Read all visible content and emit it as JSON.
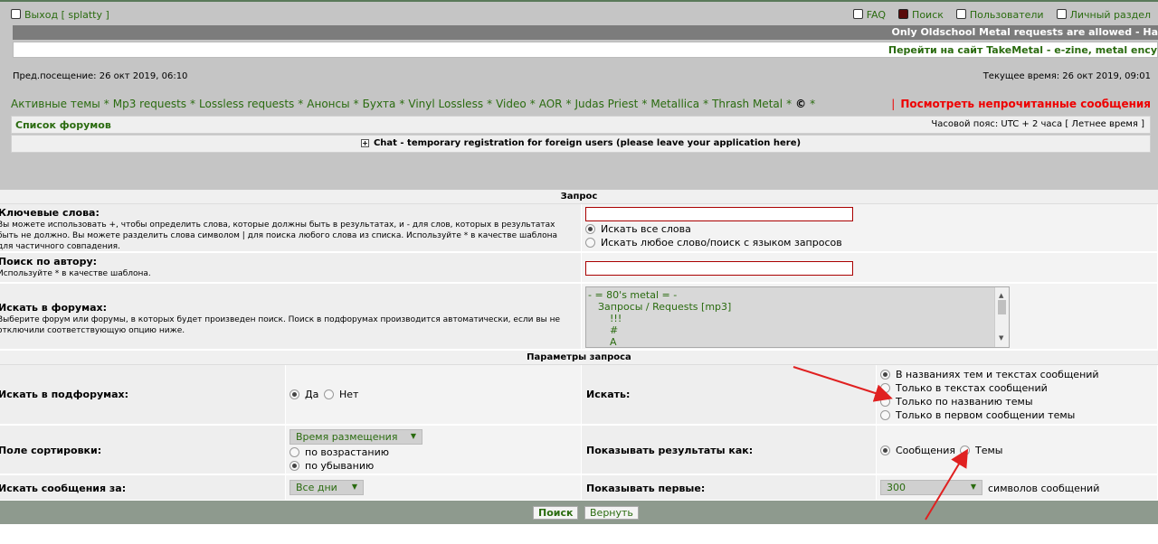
{
  "top": {
    "logout": "Выход [ splatty ]",
    "faq": "FAQ",
    "search": "Поиск",
    "users": "Пользователи",
    "personal": "Личный раздел"
  },
  "marquee1": "Only Oldschool Metal requests are allowed - Ha",
  "marquee2_link": "Перейти на сайт TakeMetal",
  "marquee2_rest": " - e-zine, metal ency",
  "last_visit": "Пред.посещение: 26 окт 2019, 06:10",
  "current_time": "Текущее время: 26 окт 2019, 09:01",
  "nav": [
    "Активные темы",
    "Mp3 requests",
    "Lossless requests",
    "Анонсы",
    "Бухта",
    "Vinyl Lossless",
    "Video",
    "AOR",
    "Judas Priest",
    "Metallica",
    "Thrash Metal"
  ],
  "nav_copy": "©",
  "nav_star": "*",
  "nav_sep": "*",
  "unread_bar": "|",
  "unread": "Посмотреть непрочитанные сообщения",
  "forum_list": "Список форумов",
  "timezone": "Часовой пояс: UTC + 2 часа [ Летнее время ]",
  "chat": "Chat - temporary registration for foreign users (please leave your application here)",
  "query_header": "Запрос",
  "keywords": {
    "label": "Ключевые слова:",
    "desc": "Вы можете использовать +, чтобы определить слова, которые должны быть в результатах, и - для слов, которых в результатах быть не должно. Вы можете разделить слова символом | для поиска любого слова из списка. Используйте * в качестве шаблона для частичного совпадения.",
    "opt_all": "Искать все слова",
    "opt_any": "Искать любое слово/поиск с языком запросов"
  },
  "author": {
    "label": "Поиск по автору:",
    "desc": "Используйте * в качестве шаблона."
  },
  "forums": {
    "label": "Искать в форумах:",
    "desc": "Выберите форум или форумы, в которых будет произведен поиск. Поиск в подфорумах производится автоматически, если вы не отключили соответствующую опцию ниже.",
    "items": [
      "- = 80's metal = -",
      "Запросы / Requests [mp3]",
      "!!!",
      "#",
      "A"
    ]
  },
  "params_header": "Параметры запроса",
  "subforums": {
    "label": "Искать в подфорумах:",
    "yes": "Да",
    "no": "Нет"
  },
  "search_in": {
    "label": "Искать:",
    "opts": [
      "В названиях тем и текстах сообщений",
      "Только в текстах сообщений",
      "Только по названию темы",
      "Только в первом сообщении темы"
    ]
  },
  "sort": {
    "label": "Поле сортировки:",
    "value": "Время размещения",
    "asc": "по возрастанию",
    "desc": "по убыванию"
  },
  "show_as": {
    "label": "Показывать результаты как:",
    "posts": "Сообщения",
    "topics": "Темы"
  },
  "period": {
    "label": "Искать сообщения за:",
    "value": "Все дни"
  },
  "show_first": {
    "label": "Показывать первые:",
    "value": "300",
    "suffix": "символов сообщений"
  },
  "buttons": {
    "search": "Поиск",
    "reset": "Вернуть"
  },
  "annotation_color": "#e02020"
}
